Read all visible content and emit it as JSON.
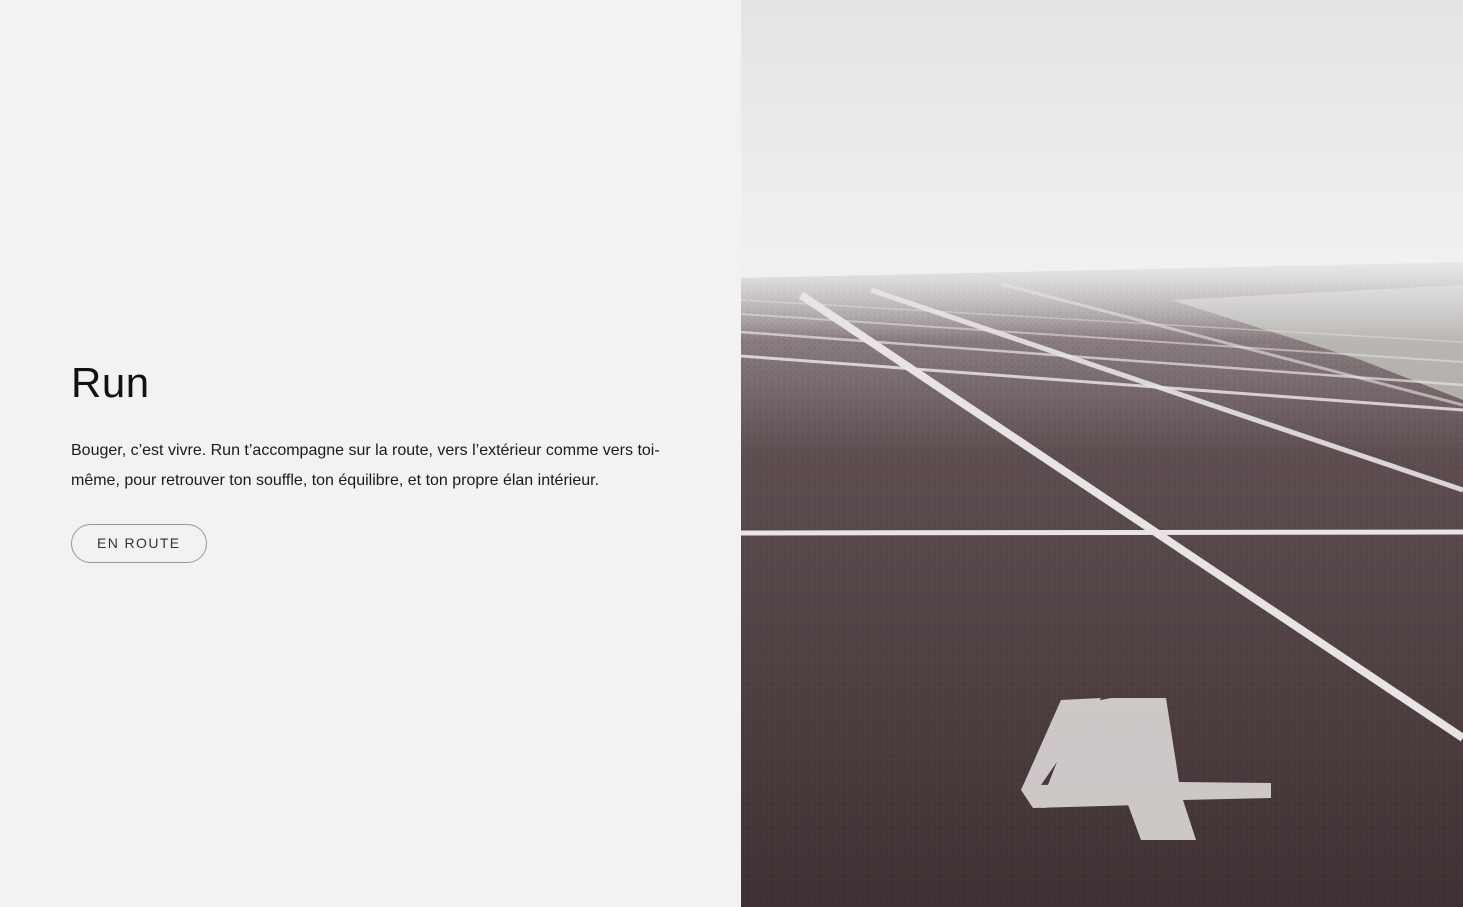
{
  "hero": {
    "title": "Run",
    "description": "Bouger, c’est vivre. Run t’accompagne sur la route, vers l’extérieur comme vers toi-même, pour retrouver ton souffle, ton équilibre, et ton propre élan intérieur.",
    "cta_label": "EN ROUTE"
  },
  "image": {
    "subject": "running-track-lane-4",
    "lane_number": "4"
  },
  "colors": {
    "left_background": "#f2f2f2",
    "track": "#4a3a3c",
    "fog": "#f0f0f0",
    "line": "#e6e2e2"
  }
}
